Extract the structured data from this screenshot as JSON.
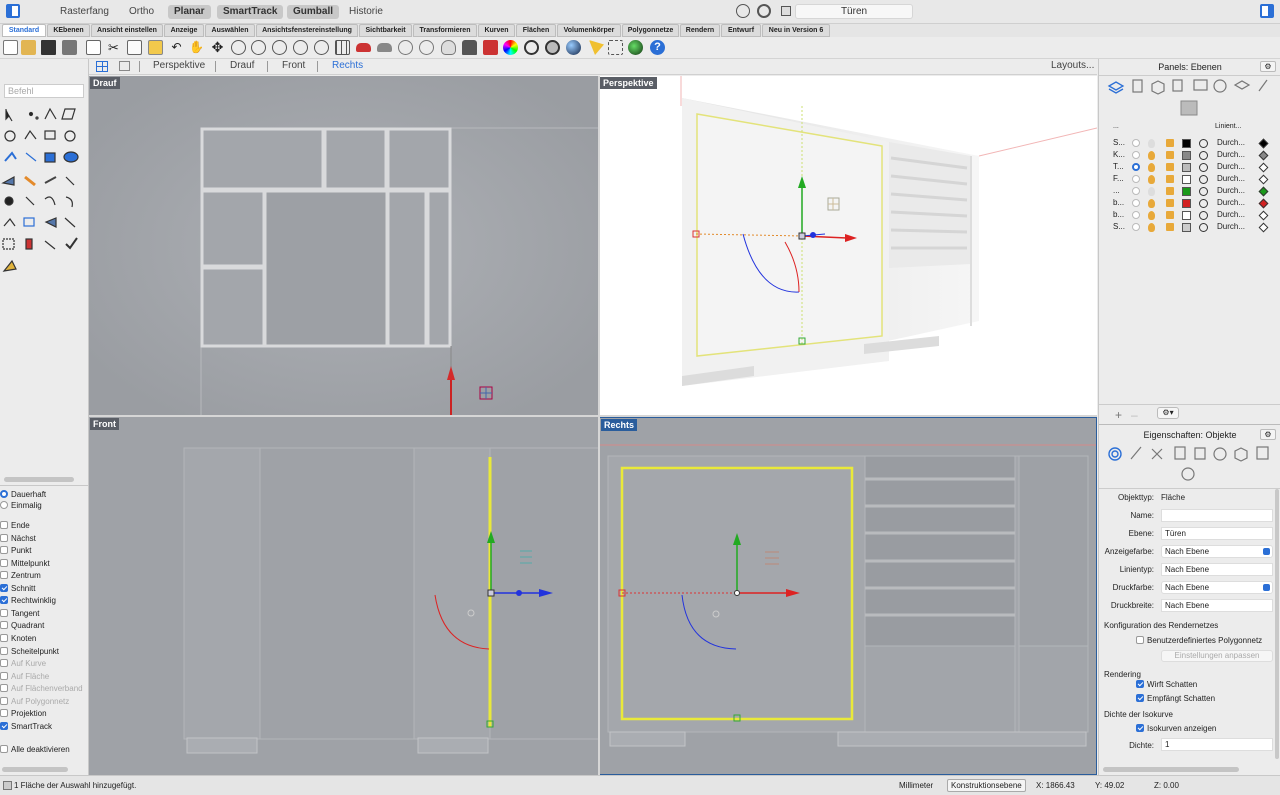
{
  "titlebar": {
    "modes": [
      "Rasterfang",
      "Ortho",
      "Planar",
      "SmartTrack",
      "Gumball",
      "Historie"
    ],
    "active_modes": [
      "Planar",
      "SmartTrack",
      "Gumball"
    ],
    "command_field": "Türen"
  },
  "ribbon_tabs": [
    "Standard",
    "KEbenen",
    "Ansicht einstellen",
    "Anzeige",
    "Auswählen",
    "Ansichtsfenstereinstellung",
    "Sichtbarkeit",
    "Transformieren",
    "Kurven",
    "Flächen",
    "Volumenkörper",
    "Polygonnetze",
    "Rendern",
    "Entwurf",
    "Neu in Version 6"
  ],
  "active_tab": "Standard",
  "viewport_tabs": [
    "Perspektive",
    "Drauf",
    "Front",
    "Rechts"
  ],
  "active_viewport_tab": "Rechts",
  "layouts_label": "Layouts...",
  "command_placeholder": "Befehl",
  "osnap": {
    "mode_options": [
      {
        "label": "Dauerhaft",
        "selected": true
      },
      {
        "label": "Einmalig",
        "selected": false
      }
    ],
    "items": [
      {
        "label": "Ende",
        "checked": false,
        "enabled": true
      },
      {
        "label": "Nächst",
        "checked": false,
        "enabled": true
      },
      {
        "label": "Punkt",
        "checked": false,
        "enabled": true
      },
      {
        "label": "Mittelpunkt",
        "checked": false,
        "enabled": true
      },
      {
        "label": "Zentrum",
        "checked": false,
        "enabled": true
      },
      {
        "label": "Schnitt",
        "checked": true,
        "enabled": true
      },
      {
        "label": "Rechtwinklig",
        "checked": true,
        "enabled": true
      },
      {
        "label": "Tangent",
        "checked": false,
        "enabled": true
      },
      {
        "label": "Quadrant",
        "checked": false,
        "enabled": true
      },
      {
        "label": "Knoten",
        "checked": false,
        "enabled": true
      },
      {
        "label": "Scheitelpunkt",
        "checked": false,
        "enabled": true
      },
      {
        "label": "Auf Kurve",
        "checked": false,
        "enabled": false
      },
      {
        "label": "Auf Fläche",
        "checked": false,
        "enabled": false
      },
      {
        "label": "Auf Flächenverband",
        "checked": false,
        "enabled": false
      },
      {
        "label": "Auf Polygonnetz",
        "checked": false,
        "enabled": false
      },
      {
        "label": "Projektion",
        "checked": false,
        "enabled": true
      },
      {
        "label": "SmartTrack",
        "checked": true,
        "enabled": true
      }
    ],
    "disable_all": "Alle deaktivieren"
  },
  "viewports": {
    "top": "Drauf",
    "perspective": "Perspektive",
    "front": "Front",
    "right": "Rechts"
  },
  "layers_panel": {
    "title": "Panels: Ebenen",
    "col_header_name": "...",
    "col_header_linetype": "Linient...",
    "layers": [
      {
        "name": "S...",
        "current": false,
        "light": false,
        "color": "#000000",
        "material": "Durch...",
        "dia": "#000000"
      },
      {
        "name": "K...",
        "current": false,
        "light": true,
        "color": "#888888",
        "material": "Durch...",
        "dia": "#888888"
      },
      {
        "name": "T...",
        "current": true,
        "light": true,
        "color": "#bbbbbb",
        "material": "Durch...",
        "dia": "#ffffff"
      },
      {
        "name": "F...",
        "current": false,
        "light": true,
        "color": "#ffffff",
        "material": "Durch...",
        "dia": "#ffffff"
      },
      {
        "name": "...",
        "current": false,
        "light": false,
        "color": "#1a9a1a",
        "material": "Durch...",
        "dia": "#1a9a1a"
      },
      {
        "name": "b...",
        "current": false,
        "light": true,
        "color": "#d22020",
        "material": "Durch...",
        "dia": "#d22020"
      },
      {
        "name": "b...",
        "current": false,
        "light": true,
        "color": "#ffffff",
        "material": "Durch...",
        "dia": "#ffffff"
      },
      {
        "name": "S...",
        "current": false,
        "light": true,
        "color": "#cccccc",
        "material": "Durch...",
        "dia": "#ffffff"
      }
    ]
  },
  "properties": {
    "title": "Eigenschaften: Objekte",
    "objekttyp_label": "Objekttyp:",
    "objekttyp": "Fläche",
    "name_label": "Name:",
    "name": "",
    "ebene_label": "Ebene:",
    "ebene": "Türen",
    "anzeigefarbe_label": "Anzeigefarbe:",
    "anzeigefarbe": "Nach Ebene",
    "linientyp_label": "Linientyp:",
    "linientyp": "Nach Ebene",
    "druckfarbe_label": "Druckfarbe:",
    "druckfarbe": "Nach Ebene",
    "druckbreite_label": "Druckbreite:",
    "druckbreite": "Nach Ebene",
    "render_mesh_header": "Konfiguration des Rendernetzes",
    "custom_mesh": "Benutzerdefiniertes Polygonnetz",
    "adjust_button": "Einstellungen anpassen",
    "rendering_header": "Rendering",
    "casts_shadows": "Wirft Schatten",
    "receives_shadows": "Empfängt Schatten",
    "isocurve_header": "Dichte der Isokurve",
    "show_isocurves": "Isokurven anzeigen",
    "density_label": "Dichte:",
    "density": "1"
  },
  "status": {
    "message": "1 Fläche der Auswahl hinzugefügt.",
    "units": "Millimeter",
    "cplane": "Konstruktionsebene",
    "x": "X: 1866.43",
    "y": "Y: 49.02",
    "z": "Z: 0.00"
  }
}
